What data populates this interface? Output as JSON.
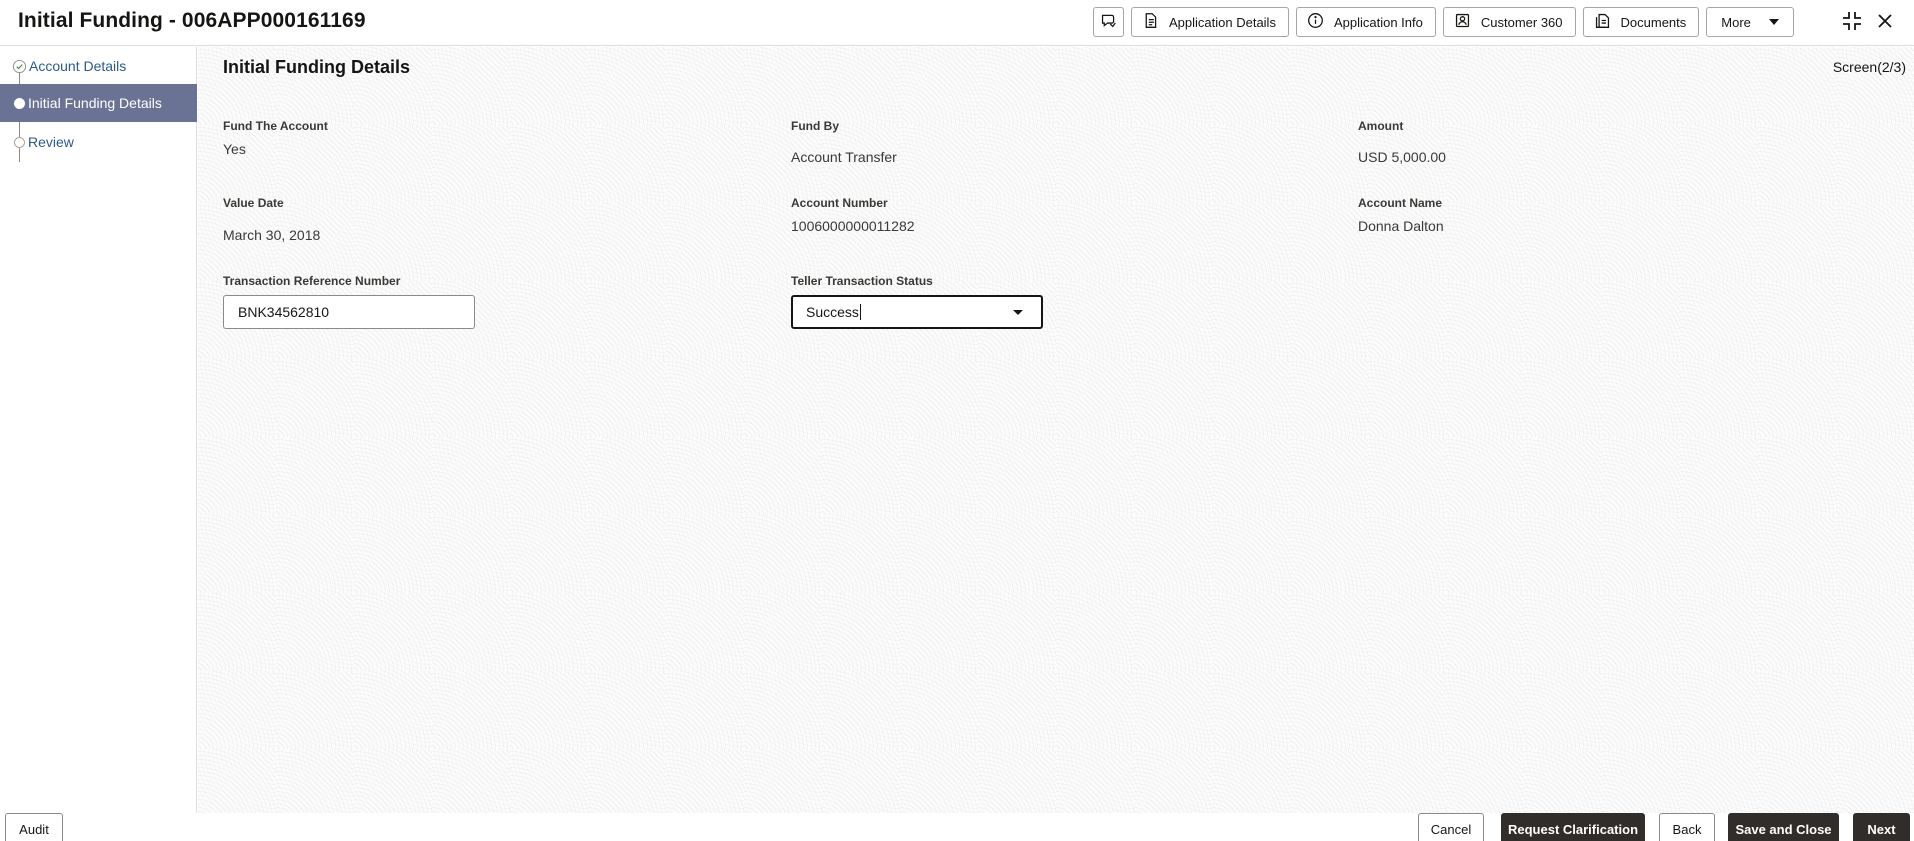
{
  "header": {
    "title": "Initial Funding - 006APP000161169",
    "toolbar": {
      "application_details": "Application Details",
      "application_info": "Application Info",
      "customer_360": "Customer 360",
      "documents": "Documents",
      "more": "More"
    }
  },
  "sidebar": {
    "steps": [
      {
        "label": "Account Details",
        "state": "completed"
      },
      {
        "label": "Initial Funding Details",
        "state": "active"
      },
      {
        "label": "Review",
        "state": "pending"
      }
    ]
  },
  "main": {
    "section_title": "Initial Funding Details",
    "screen_indicator": "Screen(2/3)",
    "fields": {
      "fund_the_account": {
        "label": "Fund The Account",
        "value": "Yes"
      },
      "fund_by": {
        "label": "Fund By",
        "value": "Account Transfer"
      },
      "amount": {
        "label": "Amount",
        "value": "USD 5,000.00"
      },
      "value_date": {
        "label": "Value Date",
        "value": "March 30, 2018"
      },
      "account_number": {
        "label": "Account Number",
        "value": "1006000000011282"
      },
      "account_name": {
        "label": "Account Name",
        "value": "Donna Dalton"
      },
      "transaction_reference_number": {
        "label": "Transaction Reference Number",
        "value": "BNK34562810"
      },
      "teller_transaction_status": {
        "label": "Teller Transaction Status",
        "value": "Success"
      }
    }
  },
  "footer": {
    "audit": "Audit",
    "cancel": "Cancel",
    "request_clarification": "Request Clarification",
    "back": "Back",
    "save_and_close": "Save and Close",
    "next": "Next"
  },
  "colors": {
    "active_step_bg": "#6b7394",
    "primary_button_bg": "#312d2a",
    "link_text": "#2c5a8a"
  }
}
